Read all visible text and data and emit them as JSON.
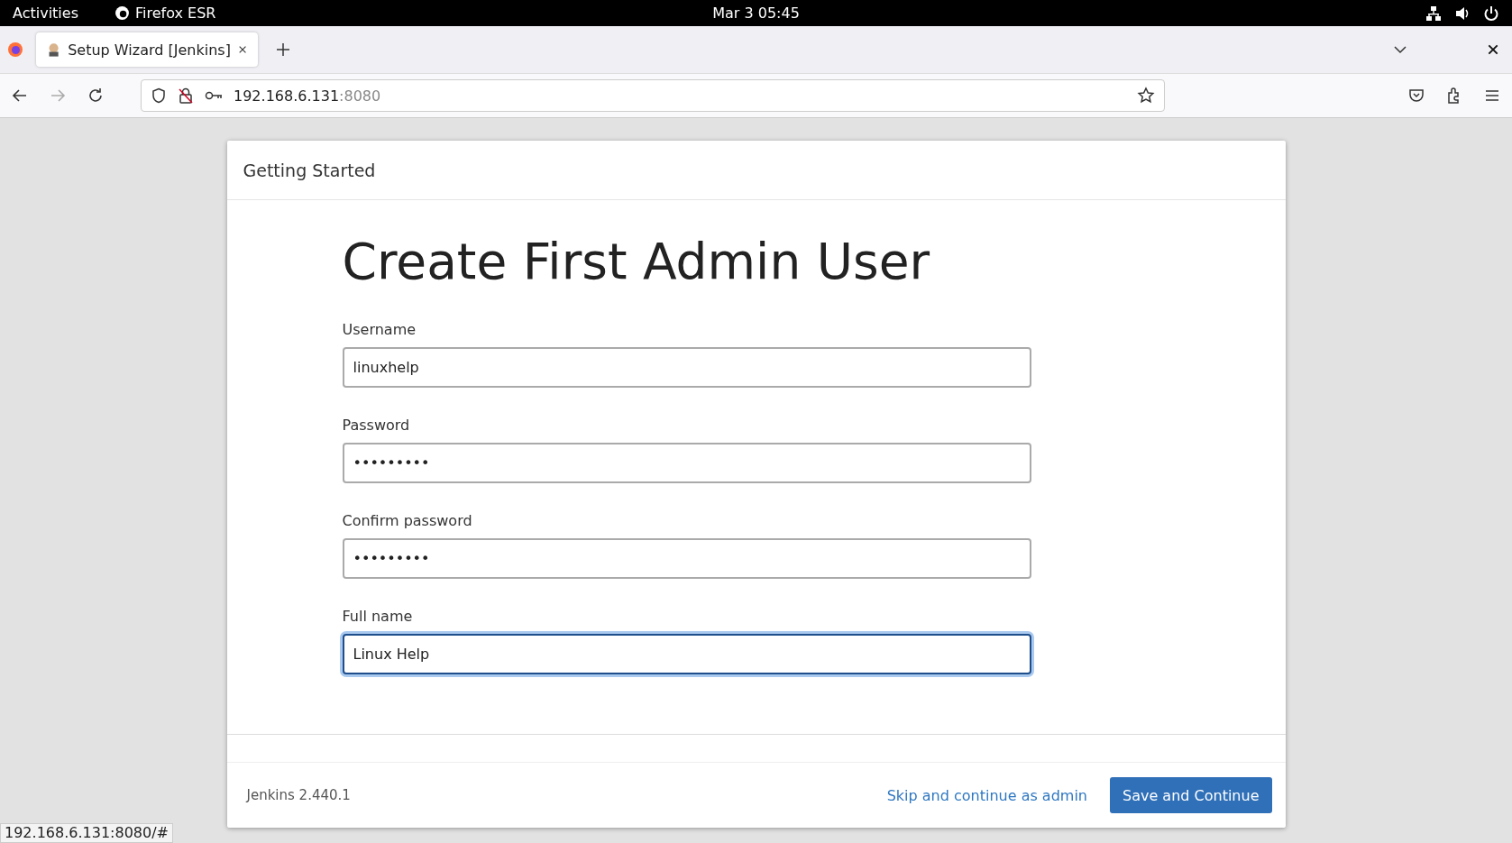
{
  "top_bar": {
    "activities": "Activities",
    "app": "Firefox ESR",
    "clock": "Mar 3  05:45"
  },
  "tabs": [
    {
      "label": "Setup Wizard [Jenkins]",
      "selected": true
    }
  ],
  "address_bar": {
    "host": "192.168.6.131",
    "port": ":8080"
  },
  "panel": {
    "header": "Getting Started",
    "title": "Create First Admin User",
    "fields": [
      {
        "label": "Username",
        "value": "linuxhelp",
        "focused": false
      },
      {
        "label": "Password",
        "value": "•••••••••",
        "focused": false
      },
      {
        "label": "Confirm password",
        "value": "•••••••••",
        "focused": false
      },
      {
        "label": "Full name",
        "value": "Linux Help",
        "focused": true
      }
    ],
    "version": "Jenkins 2.440.1",
    "skip_link": "Skip and continue as admin",
    "save_button": "Save and Continue"
  },
  "status_bar": "192.168.6.131:8080/#"
}
